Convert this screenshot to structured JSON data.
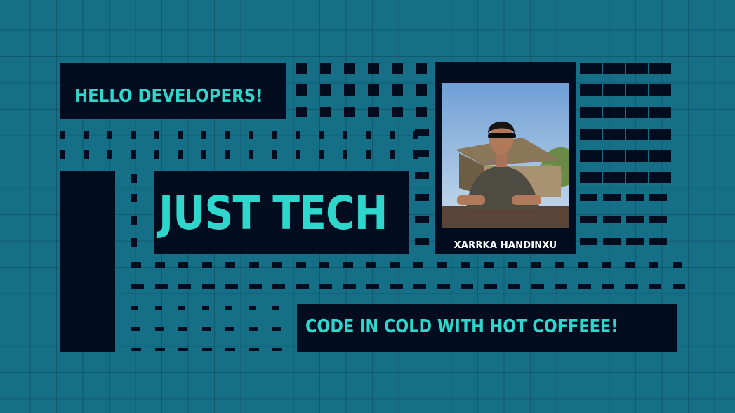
{
  "banner": {
    "greeting": "HELLO DEVELOPERS!",
    "title": "JUST TECH",
    "tagline": "CODE IN COLD WITH HOT COFFEEE!",
    "person_name": "XARRKA HANDINXU"
  },
  "colors": {
    "background": "#146f87",
    "panel": "#020c1f",
    "accent_text": "#2ed6cc",
    "name_text": "#ffffff"
  },
  "icons": {
    "portrait": "person-with-sunglasses-photo"
  }
}
